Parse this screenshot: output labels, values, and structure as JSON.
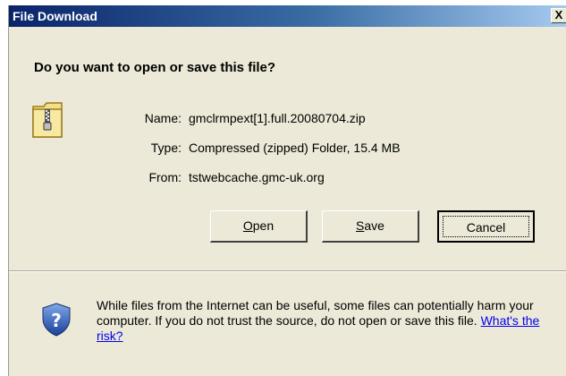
{
  "window": {
    "title": "File Download",
    "close_label": "X"
  },
  "heading": "Do you want to open or save this file?",
  "icons": {
    "file": "zip-folder-icon",
    "security": "shield-question-icon"
  },
  "file_info": {
    "name_label": "Name:",
    "name_value": "gmclrmpext[1].full.20080704.zip",
    "type_label": "Type:",
    "type_value": "Compressed (zipped) Folder, 15.4 MB",
    "from_label": "From:",
    "from_value": "tstwebcache.gmc-uk.org"
  },
  "buttons": {
    "open_mnemonic": "O",
    "open_rest": "pen",
    "save_mnemonic": "S",
    "save_rest": "ave",
    "cancel": "Cancel"
  },
  "warning": {
    "text": "While files from the Internet can be useful, some files can potentially harm your computer. If you do not trust the source, do not open or save this file.",
    "link": "What's the risk?"
  },
  "colors": {
    "title_bar": "#0a246a",
    "dialog_face": "#ece9d8",
    "link": "#0000ee"
  }
}
